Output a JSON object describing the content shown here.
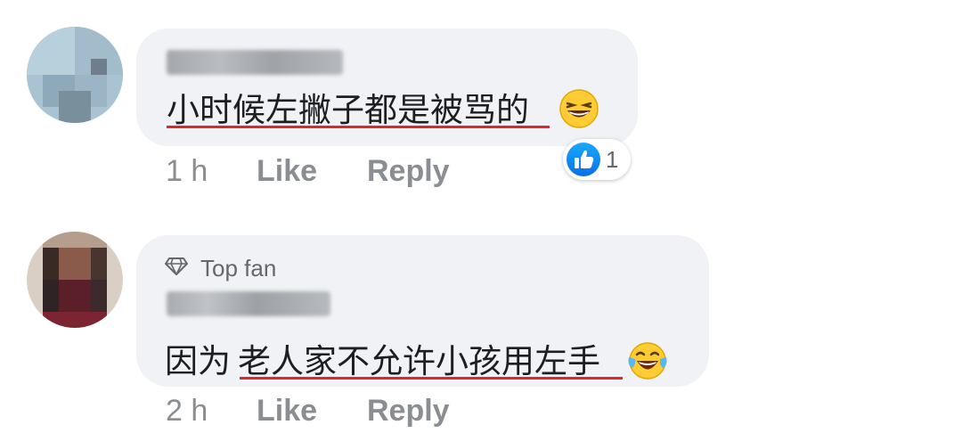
{
  "comments": [
    {
      "text_a": "小时候左撇子都是被骂的",
      "time": "1 h",
      "like_label": "Like",
      "reply_label": "Reply",
      "reaction_count": "1",
      "reaction_icon": "thumbs-up-icon",
      "emoji_icon": "grinning-squinting-face-icon"
    },
    {
      "badge": "Top fan",
      "badge_icon": "diamond-icon",
      "text_a": "因为",
      "text_b": "老人家不允许小孩用左手",
      "time": "2 h",
      "like_label": "Like",
      "reply_label": "Reply",
      "emoji_icon": "face-with-tears-of-joy-icon"
    }
  ],
  "colors": {
    "bubble": "#f0f2f5",
    "underline": "#e0262b",
    "meta": "#8a8d91",
    "like_blue": "#1877f2"
  }
}
